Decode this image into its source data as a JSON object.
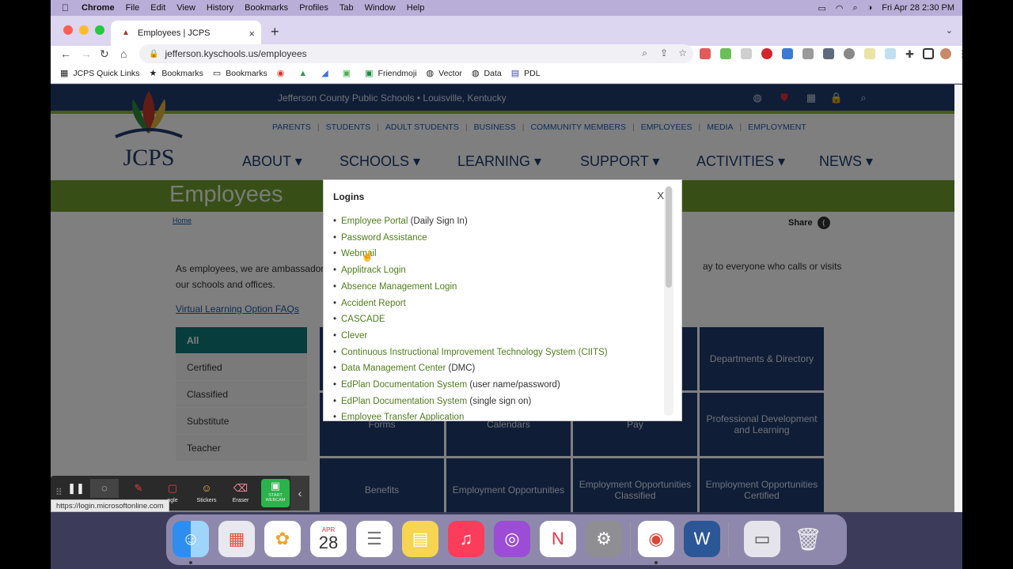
{
  "menubar": {
    "apple": "",
    "app": "Chrome",
    "items": [
      "File",
      "Edit",
      "View",
      "History",
      "Bookmarks",
      "Profiles",
      "Tab",
      "Window",
      "Help"
    ],
    "datetime": "Fri Apr 28  2:30 PM"
  },
  "tab": {
    "title": "Employees | JCPS",
    "close": "×",
    "new": "+",
    "dropdown": "⌄"
  },
  "toolbar": {
    "back": "←",
    "forward": "→",
    "reload": "↻",
    "home": "⌂",
    "url": "jefferson.kyschools.us/employees"
  },
  "bookmarks": [
    {
      "icon": "▦",
      "label": "JCPS Quick Links"
    },
    {
      "icon": "★",
      "label": "Bookmarks"
    },
    {
      "icon": "▭",
      "label": "Bookmarks"
    },
    {
      "icon": "◉",
      "label": ""
    },
    {
      "icon": "▲",
      "label": ""
    },
    {
      "icon": "◢",
      "label": ""
    },
    {
      "icon": "▣",
      "label": ""
    },
    {
      "icon": "▣",
      "label": "Friendmoji"
    },
    {
      "icon": "◍",
      "label": "Vector"
    },
    {
      "icon": "◍",
      "label": "Data"
    },
    {
      "icon": "▤",
      "label": "PDL"
    }
  ],
  "site": {
    "topbar": "Jefferson County Public Schools • Louisville, Kentucky",
    "subnav": [
      "PARENTS",
      "STUDENTS",
      "ADULT STUDENTS",
      "BUSINESS",
      "COMMUNITY MEMBERS",
      "EMPLOYEES",
      "MEDIA",
      "EMPLOYMENT"
    ],
    "logo_text": "JCPS",
    "mainnav": [
      "ABOUT",
      "SCHOOLS",
      "LEARNING",
      "SUPPORT",
      "ACTIVITIES",
      "NEWS"
    ],
    "page_title": "Employees",
    "breadcrumb": "Home",
    "share": "Share",
    "intro": "As employees, we are ambassador",
    "intro_line2": "our schools and offices.",
    "intro_right": "ay to everyone who calls or visits",
    "faq": "Virtual Learning Option FAQs",
    "filters": [
      "All",
      "Certified",
      "Classified",
      "Substitute",
      "Teacher"
    ],
    "tiles": [
      "Departments & Directory",
      "Forms",
      "Calendars",
      "Pay",
      "Professional Development and Learning",
      "Benefits",
      "Employment Opportunities",
      "Employment Opportunities Classified",
      "Employment Opportunities Certified"
    ]
  },
  "modal": {
    "title": "Logins",
    "close": "X",
    "items": [
      {
        "link": "Employee Portal",
        "note": " (Daily Sign In)"
      },
      {
        "link": "Password Assistance",
        "note": ""
      },
      {
        "link": "Webmail",
        "note": ""
      },
      {
        "link": "Applitrack Login",
        "note": ""
      },
      {
        "link": "Absence Management Login",
        "note": ""
      },
      {
        "link": "Accident Report",
        "note": ""
      },
      {
        "link": "CASCADE",
        "note": ""
      },
      {
        "link": "Clever",
        "note": ""
      },
      {
        "link": "Continuous Instructional Improvement Technology System (CIITS)",
        "note": ""
      },
      {
        "link": "Data Management Center",
        "note": " (DMC)"
      },
      {
        "link": "EdPlan Documentation System",
        "note": " (user name/password)"
      },
      {
        "link": "EdPlan Documentation System",
        "note": " (single sign on)"
      },
      {
        "link": "Employee Transfer Application",
        "note": ""
      }
    ]
  },
  "recorder": {
    "buttons": [
      {
        "icon": "❚❚",
        "label": ""
      },
      {
        "icon": "◌",
        "label": ""
      },
      {
        "icon": "✎",
        "label": ""
      },
      {
        "icon": "▢",
        "label": "ngle"
      },
      {
        "icon": "☺",
        "label": "Stickers"
      },
      {
        "icon": "⌫",
        "label": "Eraser"
      },
      {
        "icon": "▣",
        "label": "START WEBCAM"
      }
    ],
    "collapse": "‹"
  },
  "statusbar": "https://login.microsoftonline.com",
  "dock": {
    "calendar_month": "APR",
    "calendar_day": "28"
  }
}
